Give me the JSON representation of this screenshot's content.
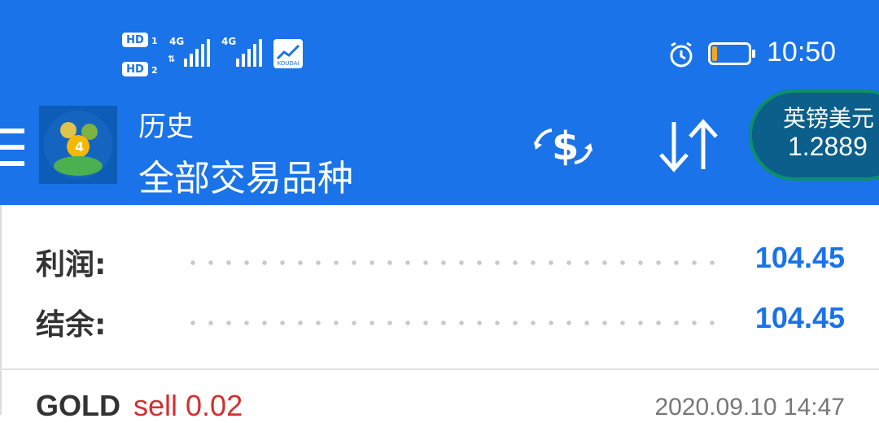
{
  "status_bar": {
    "hd1": "HD",
    "hd1_sub": "1",
    "hd2": "HD",
    "hd2_sub": "2",
    "net1": "4G",
    "net2": "4G",
    "app_icon_label": "KOUDAI",
    "time": "10:50",
    "battery_level": 0.15
  },
  "toolbar": {
    "title": "历史",
    "subtitle": "全部交易品种"
  },
  "ticker": {
    "name": "英镑美元",
    "price": "1.2889"
  },
  "summary": {
    "profit_label": "利润:",
    "profit_value": "104.45",
    "balance_label": "结余:",
    "balance_value": "104.45"
  },
  "trade": {
    "symbol": "GOLD",
    "type": "sell 0.02",
    "time": "2020.09.10 14:47"
  },
  "colors": {
    "toolbar": "#1a73e8",
    "value_blue": "#1a73e8",
    "sell_red": "#d32f2f"
  }
}
